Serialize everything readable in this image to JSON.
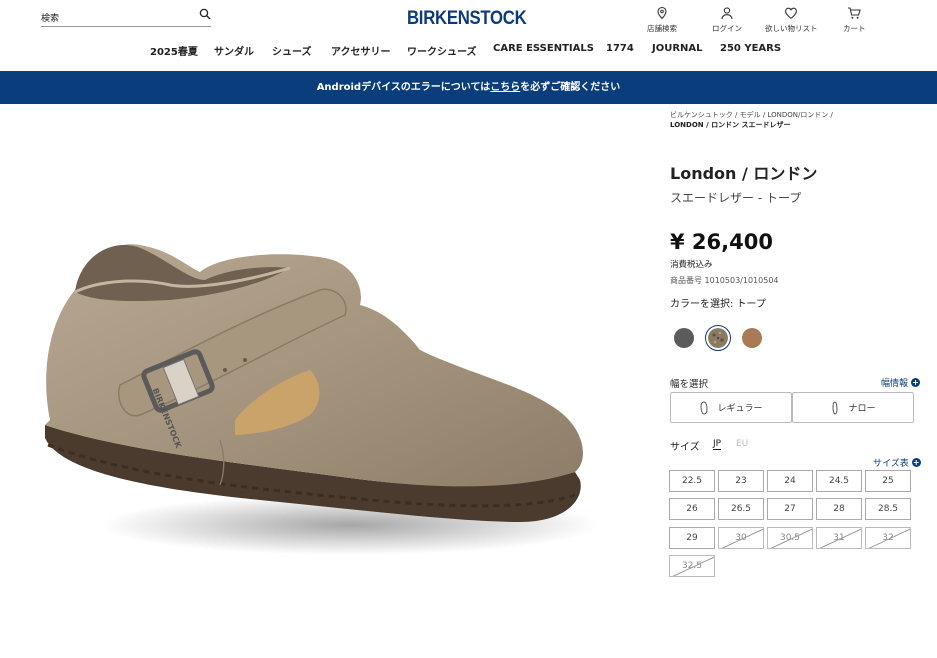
{
  "header": {
    "search_placeholder": "検索",
    "logo": "BIRKENSTOCK",
    "utilities": [
      {
        "label": "店舗検索",
        "icon": "location-pin-icon"
      },
      {
        "label": "ログイン",
        "icon": "user-icon"
      },
      {
        "label": "欲しい物リスト",
        "icon": "heart-icon"
      },
      {
        "label": "カート",
        "icon": "cart-icon"
      }
    ]
  },
  "nav": [
    "2025春夏",
    "サンダル",
    "シューズ",
    "アクセサリー",
    "ワークシューズ",
    "CARE ESSENTIALS",
    "1774",
    "JOURNAL",
    "250 YEARS"
  ],
  "banner": {
    "before": "Androidデバイスのエラーについては",
    "link": "こちら",
    "after": "を必ずご確認ください"
  },
  "breadcrumb": {
    "items": [
      "ビルケンシュトック",
      "モデル",
      "LONDON/ロンドン"
    ],
    "current": "LONDON / ロンドン スエードレザー"
  },
  "product": {
    "title": "London / ロンドン",
    "subtitle": "スエードレザー - トープ",
    "price": "¥ 26,400",
    "tax_note": "消費税込み",
    "sku": "商品番号 1010503/1010504",
    "color_label": "カラーを選択: トープ"
  },
  "colors": [
    {
      "name": "gray",
      "hex": "#5b5b5b",
      "selected": false
    },
    {
      "name": "taupe",
      "hex": "#8a7a62",
      "selected": true
    },
    {
      "name": "cognac",
      "hex": "#a87a55",
      "selected": false
    }
  ],
  "width": {
    "label": "幅を選択",
    "info": "幅情報",
    "options": [
      "レギュラー",
      "ナロー"
    ]
  },
  "sizes": {
    "label": "サイズ",
    "units": [
      "JP",
      "EU"
    ],
    "chart_link": "サイズ表",
    "items": [
      {
        "label": "22.5",
        "available": true
      },
      {
        "label": "23",
        "available": true
      },
      {
        "label": "24",
        "available": true
      },
      {
        "label": "24.5",
        "available": true
      },
      {
        "label": "25",
        "available": true
      },
      {
        "label": "26",
        "available": true
      },
      {
        "label": "26.5",
        "available": true
      },
      {
        "label": "27",
        "available": true
      },
      {
        "label": "28",
        "available": true
      },
      {
        "label": "28.5",
        "available": true
      },
      {
        "label": "29",
        "available": true
      },
      {
        "label": "30",
        "available": false
      },
      {
        "label": "30.5",
        "available": false
      },
      {
        "label": "31",
        "available": false
      },
      {
        "label": "32",
        "available": false
      },
      {
        "label": "32.5",
        "available": false
      }
    ]
  },
  "colors_theme": {
    "brand_blue": "#0a3d7c"
  }
}
